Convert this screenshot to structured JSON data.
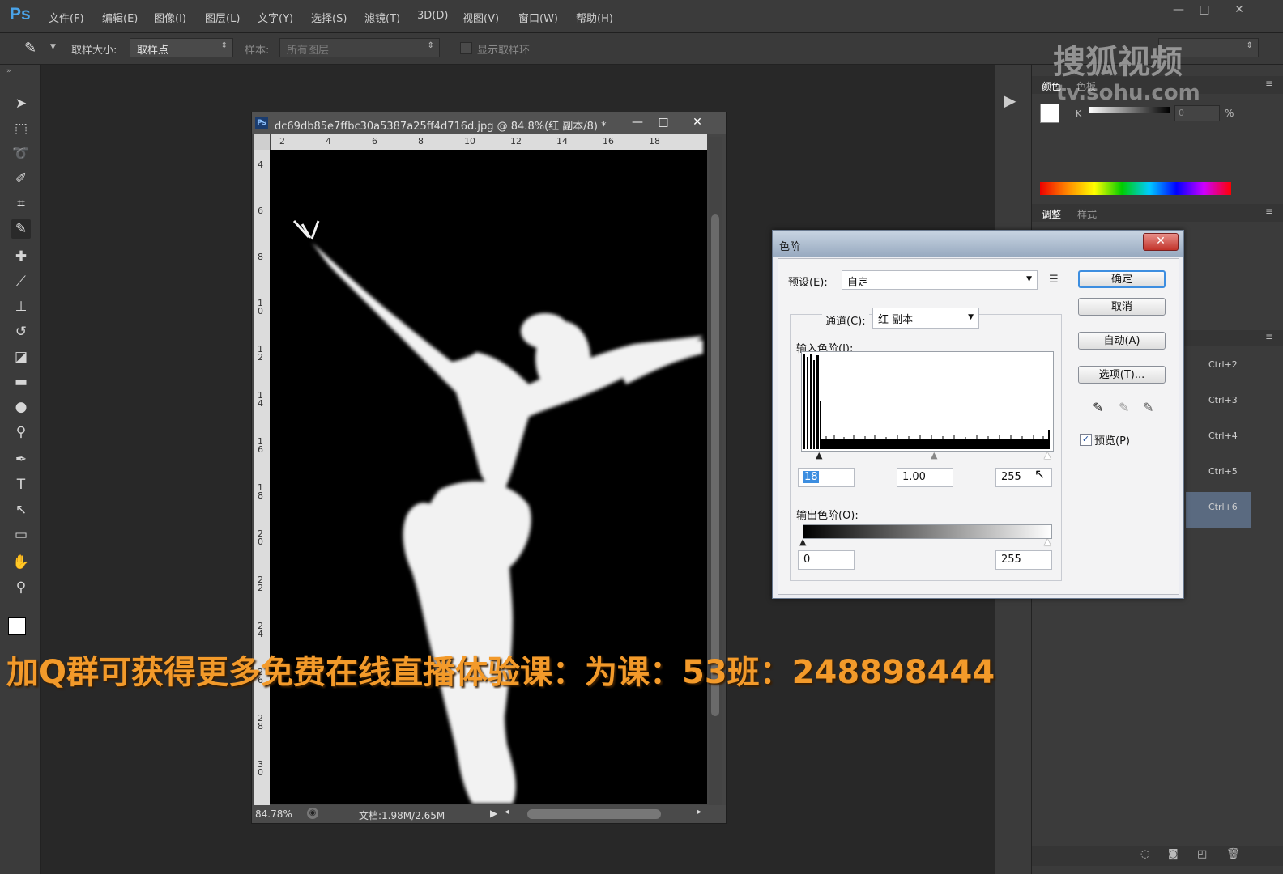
{
  "menu": {
    "logo": "Ps",
    "items": [
      "文件(F)",
      "编辑(E)",
      "图像(I)",
      "图层(L)",
      "文字(Y)",
      "选择(S)",
      "滤镜(T)",
      "3D(D)",
      "视图(V)",
      "窗口(W)",
      "帮助(H)"
    ],
    "window_controls": [
      "—",
      "□",
      "✕"
    ]
  },
  "options": {
    "sample_size_label": "取样大小:",
    "sample_size_value": "取样点",
    "sample_label": "样本:",
    "sample_value": "所有图层",
    "show_ring_label": "显示取样环"
  },
  "tools": [
    "move-icon",
    "marquee-icon",
    "lasso-icon",
    "quick-select-icon",
    "crop-icon",
    "eyedropper-icon",
    "healing-icon",
    "brush-icon",
    "stamp-icon",
    "history-brush-icon",
    "eraser-icon",
    "gradient-icon",
    "blur-icon",
    "dodge-icon",
    "pen-icon",
    "type-icon",
    "path-select-icon",
    "rectangle-icon",
    "hand-icon",
    "zoom-icon"
  ],
  "document": {
    "title": "dc69db85e7ffbc30a5387a25ff4d716d.jpg @ 84.8%(红 副本/8) *",
    "ruler_h": [
      "2",
      "4",
      "6",
      "8",
      "10",
      "12",
      "14",
      "16",
      "18"
    ],
    "ruler_v": [
      "4",
      "6",
      "8",
      "1\n0",
      "1\n2",
      "1\n4",
      "1\n6",
      "1\n8",
      "2\n0",
      "2\n2",
      "2\n4",
      "2\n6",
      "2\n8",
      "3\n0"
    ],
    "zoom": "84.78%",
    "doc_info": "文档:1.98M/2.65M"
  },
  "panels": {
    "color_tab": "颜色",
    "swatches_tab": "色板",
    "k_label": "K",
    "k_value": "0",
    "percent": "%",
    "adjust_tab": "调整",
    "styles_tab": "样式",
    "shortcuts": [
      "Ctrl+2",
      "Ctrl+3",
      "Ctrl+4",
      "Ctrl+5",
      "Ctrl+6"
    ]
  },
  "levels": {
    "title": "色阶",
    "close": "✕",
    "preset_label": "预设(E):",
    "preset_value": "自定",
    "channel_label": "通道(C):",
    "channel_value": "红 副本",
    "input_label": "输入色阶(I):",
    "input_black": "18",
    "input_gamma": "1.00",
    "input_white": "255",
    "output_label": "输出色阶(O):",
    "output_black": "0",
    "output_white": "255",
    "ok_button": "确定",
    "cancel_button": "取消",
    "auto_button": "自动(A)",
    "options_button": "选项(T)...",
    "preview_label": "预览(P)",
    "preview_checked": true
  },
  "overlay": {
    "promo": "加Q群可获得更多免费在线直播体验课：为课：53班：248898444",
    "watermark_main": "搜狐视频",
    "watermark_url": "tv.sohu.com"
  }
}
